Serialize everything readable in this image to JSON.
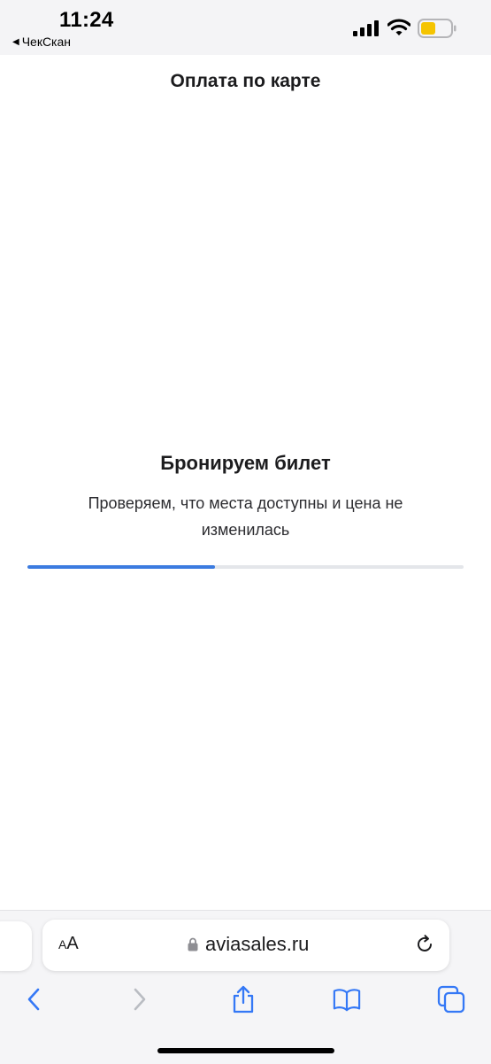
{
  "status_bar": {
    "time": "11:24",
    "back_app_label": "ЧекСкан",
    "back_app_icon": "back-triangle-icon",
    "battery_color": "#f5c400"
  },
  "page": {
    "title": "Оплата по карте",
    "booking_title": "Бронируем билет",
    "booking_subtitle": "Проверяем, что места доступны и цена не изменилась",
    "progress_fraction": 0.43,
    "accent_color": "#3b7be0"
  },
  "browser": {
    "text_size_label_small": "A",
    "text_size_label_large": "A",
    "url": "aviasales.ru",
    "toolbar_icons": [
      "back-icon",
      "forward-icon",
      "share-icon",
      "bookmarks-icon",
      "tabs-icon"
    ]
  }
}
